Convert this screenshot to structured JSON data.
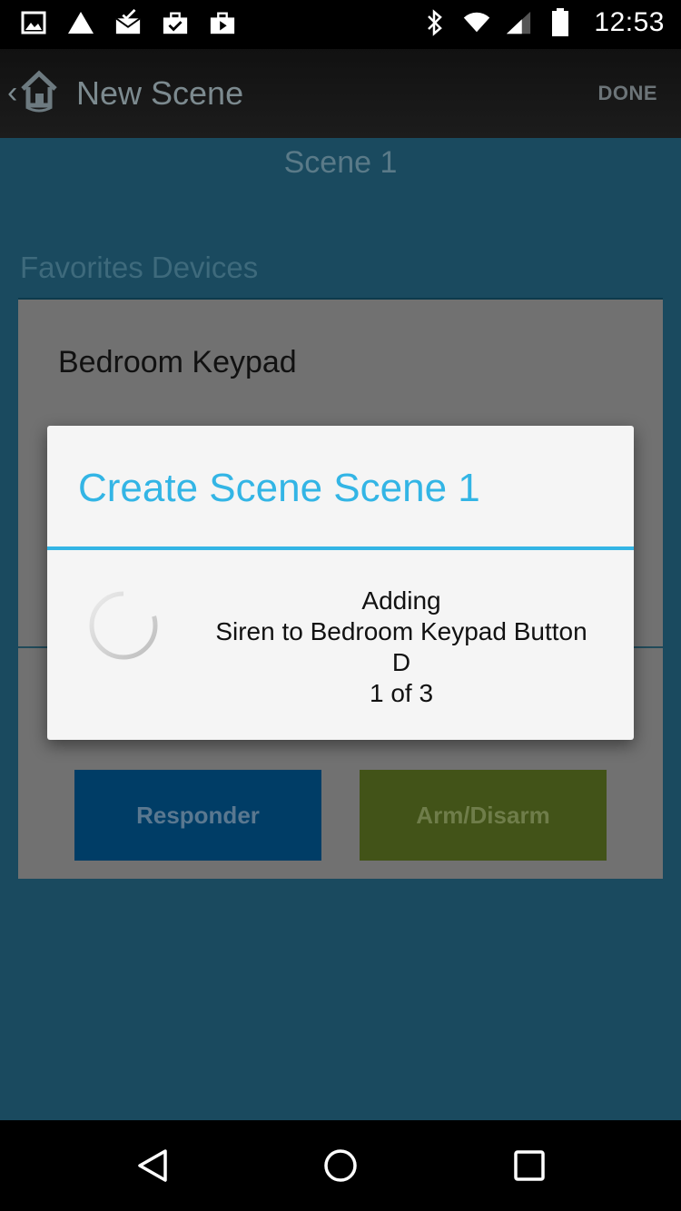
{
  "status_bar": {
    "time": "12:53",
    "left_icons": [
      "image-icon",
      "warning-icon",
      "mail-check-icon",
      "briefcase-check-icon",
      "briefcase-play-icon"
    ],
    "right_icons": [
      "bluetooth-icon",
      "wifi-icon",
      "signal-icon",
      "battery-icon"
    ]
  },
  "action_bar": {
    "title": "New Scene",
    "done_label": "DONE"
  },
  "content": {
    "scene_name": "Scene 1",
    "section_title": "Favorites Devices",
    "device_name": "Bedroom Keypad",
    "responder_label": "Responder",
    "arm_label": "Arm/Disarm"
  },
  "dialog": {
    "title": "Create Scene Scene 1",
    "message_lines": [
      "Adding",
      "Siren to Bedroom Keypad Button",
      "D",
      "1 of 3"
    ]
  },
  "colors": {
    "accent": "#33b5e5",
    "content_bg": "#1a4a5f",
    "responder_bg": "#003d66",
    "arm_bg": "#425318"
  }
}
